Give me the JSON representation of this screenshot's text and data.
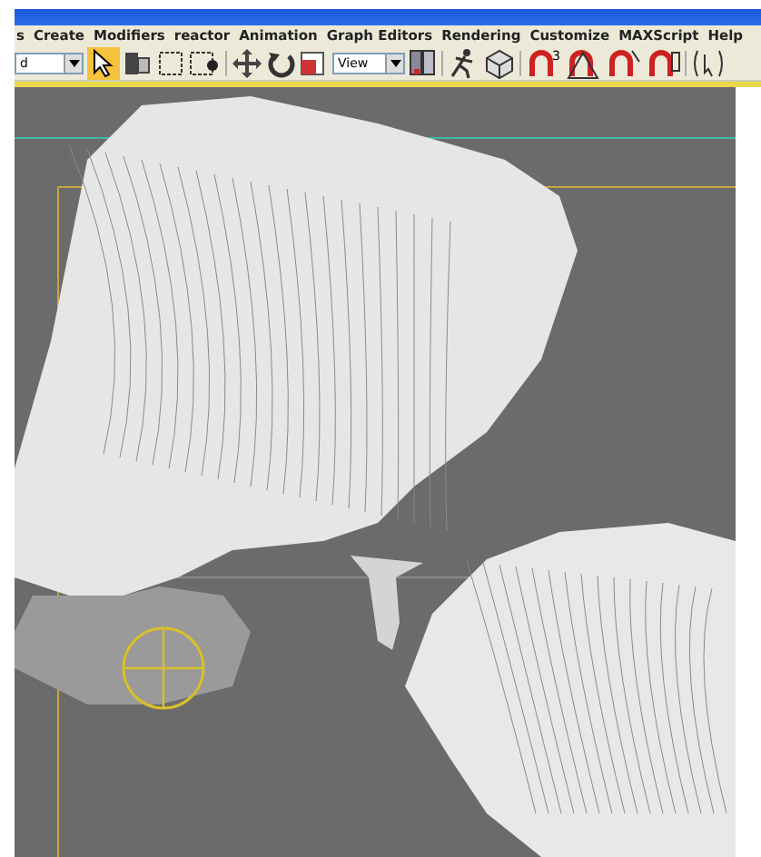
{
  "menu_bar": {
    "items": [
      {
        "label": "s"
      },
      {
        "label": "Create"
      },
      {
        "label": "Modifiers"
      },
      {
        "label": "reactor"
      },
      {
        "label": "Animation"
      },
      {
        "label": "Graph Editors"
      },
      {
        "label": "Rendering"
      },
      {
        "label": "Customize"
      },
      {
        "label": "MAXScript"
      },
      {
        "label": "Help"
      }
    ]
  },
  "toolbar": {
    "selection_filter": {
      "value": "d"
    },
    "select_tool": {
      "selected": true
    },
    "reference_coords": {
      "value": "View"
    },
    "snap_toggle": {
      "label": "3"
    }
  }
}
